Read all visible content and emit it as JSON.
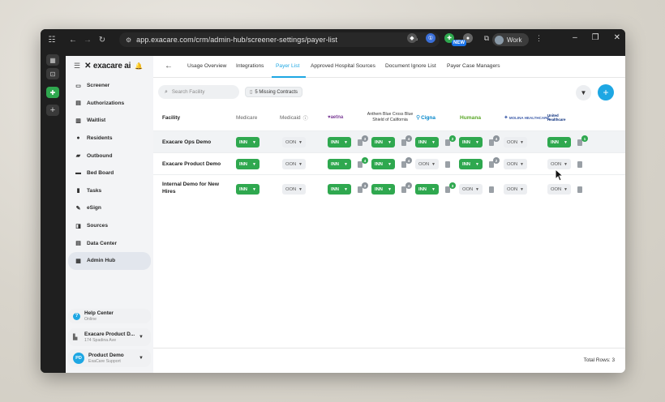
{
  "browser": {
    "url": "app.exacare.com/crm/admin-hub/screener-settings/payer-list",
    "profile_label": "Work",
    "new_badge": "NEW"
  },
  "app": {
    "brand": "exacare ai",
    "nav": [
      {
        "label": "Screener",
        "icon": "screener-icon"
      },
      {
        "label": "Authorizations",
        "icon": "authorizations-icon"
      },
      {
        "label": "Waitlist",
        "icon": "list-icon"
      },
      {
        "label": "Residents",
        "icon": "person-icon"
      },
      {
        "label": "Outbound",
        "icon": "folder-icon"
      },
      {
        "label": "Bed Board",
        "icon": "bed-icon"
      },
      {
        "label": "Tasks",
        "icon": "clipboard-icon"
      },
      {
        "label": "eSign",
        "icon": "pen-icon"
      },
      {
        "label": "Sources",
        "icon": "sources-icon"
      },
      {
        "label": "Data Center",
        "icon": "data-icon"
      },
      {
        "label": "Admin Hub",
        "icon": "admin-icon",
        "active": true
      }
    ],
    "help": {
      "title": "Help Center",
      "status": "Online"
    },
    "facility_switch": {
      "name": "Exacare Product D...",
      "address": "174 Spadina Ave"
    },
    "user": {
      "initials": "PD",
      "name": "Product Demo",
      "role": "ExaCare Support"
    }
  },
  "tabs": [
    "Usage Overview",
    "Integrations",
    "Payer List",
    "Approved Hospital Sources",
    "Document Ignore List",
    "Payer Case Managers"
  ],
  "active_tab": "Payer List",
  "toolbar": {
    "search_placeholder": "Search Facility",
    "missing_contracts": "5 Missing Contracts"
  },
  "table": {
    "headers": {
      "facility": "Facility",
      "medicare": "Medicare",
      "medicaid": "Medicaid",
      "aetna": "♥aetna",
      "anthem": "Anthem Blue Cross Blue Shield of California",
      "cigna": "Cigna",
      "humana": "Humana",
      "molina": "MOLINA HEALTHCARE",
      "uhc": "United Healthcare"
    },
    "rows": [
      {
        "facility": "Exacare Ops Demo",
        "medicare": "INN",
        "medicaid": "OON",
        "aetna": "INN",
        "aetna_docs": "3",
        "anthem": "INN",
        "anthem_docs": "4",
        "cigna": "INN",
        "cigna_docs": "2",
        "humana": "INN",
        "humana_docs": "4",
        "molina": "OON",
        "uhc": "INN",
        "uhc_docs": "1"
      },
      {
        "facility": "Exacare Product Demo",
        "medicare": "INN",
        "medicaid": "OON",
        "aetna": "INN",
        "aetna_docs": "4",
        "anthem": "INN",
        "anthem_docs": "4",
        "cigna": "OON",
        "humana": "INN",
        "humana_docs": "2",
        "molina": "OON",
        "uhc": "OON"
      },
      {
        "facility": "Internal Demo for New Hires",
        "medicare": "INN",
        "medicaid": "OON",
        "aetna": "INN",
        "aetna_docs": "3",
        "anthem": "INN",
        "anthem_docs": "4",
        "cigna": "INN",
        "cigna_docs": "3",
        "humana": "OON",
        "molina": "OON",
        "uhc": "OON"
      }
    ],
    "total_rows": "Total Rows: 3"
  },
  "colors": {
    "accent": "#1ea7e3",
    "inn_green": "#2fa84f"
  }
}
